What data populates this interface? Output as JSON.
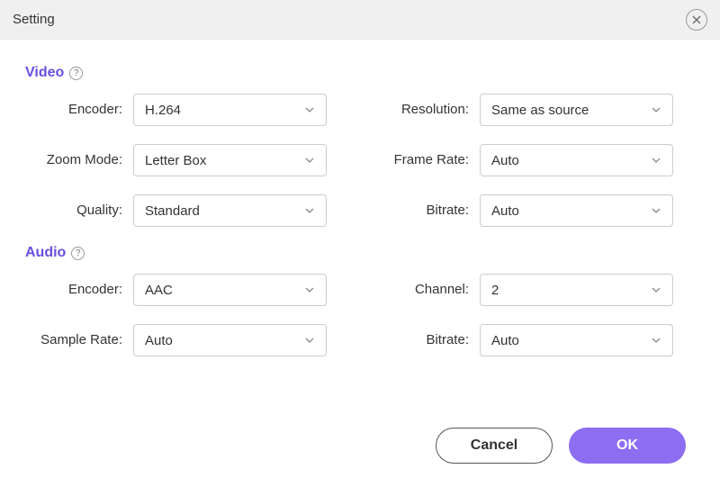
{
  "window": {
    "title": "Setting"
  },
  "sections": {
    "video": {
      "title": "Video"
    },
    "audio": {
      "title": "Audio"
    }
  },
  "fields": {
    "video_encoder": {
      "label": "Encoder:",
      "value": "H.264"
    },
    "resolution": {
      "label": "Resolution:",
      "value": "Same as source"
    },
    "zoom_mode": {
      "label": "Zoom Mode:",
      "value": "Letter Box"
    },
    "frame_rate": {
      "label": "Frame Rate:",
      "value": "Auto"
    },
    "quality": {
      "label": "Quality:",
      "value": "Standard"
    },
    "video_bitrate": {
      "label": "Bitrate:",
      "value": "Auto"
    },
    "audio_encoder": {
      "label": "Encoder:",
      "value": "AAC"
    },
    "channel": {
      "label": "Channel:",
      "value": "2"
    },
    "sample_rate": {
      "label": "Sample Rate:",
      "value": "Auto"
    },
    "audio_bitrate": {
      "label": "Bitrate:",
      "value": "Auto"
    }
  },
  "buttons": {
    "cancel": "Cancel",
    "ok": "OK"
  },
  "help_glyph": "?"
}
